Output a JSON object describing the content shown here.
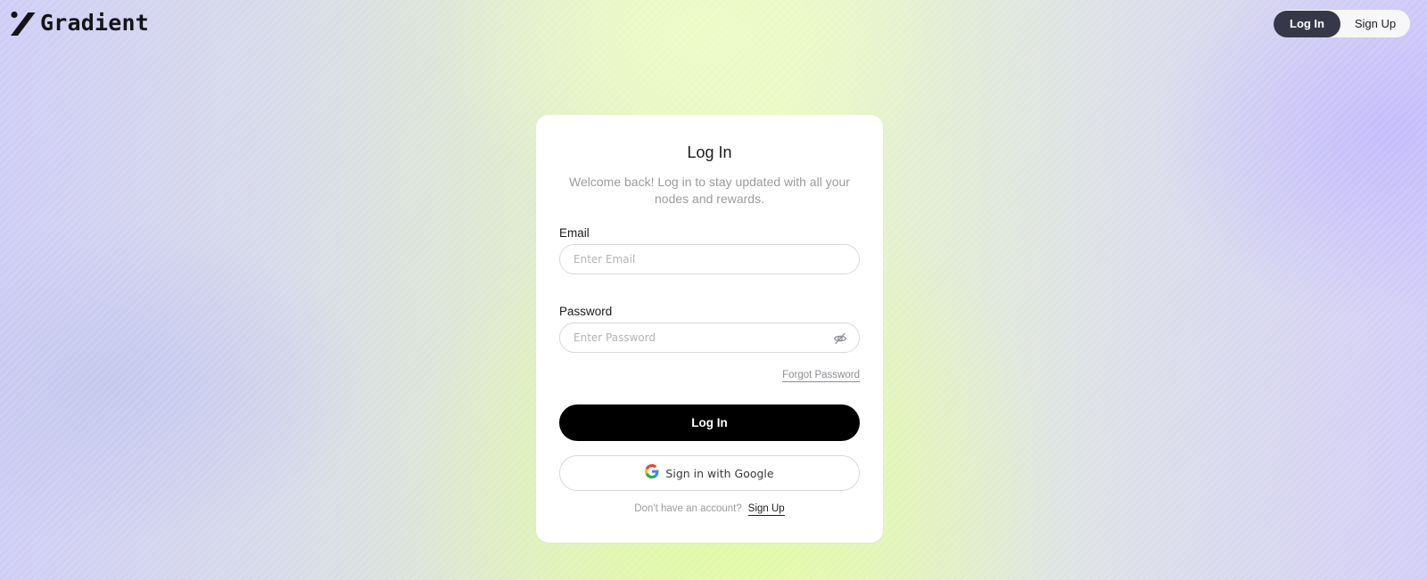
{
  "header": {
    "logo_text": "Gradient",
    "login_label": "Log In",
    "signup_label": "Sign Up"
  },
  "card": {
    "title": "Log In",
    "subtitle": "Welcome back! Log in to stay updated with all your nodes and rewards.",
    "email": {
      "label": "Email",
      "placeholder": "Enter Email",
      "value": ""
    },
    "password": {
      "label": "Password",
      "placeholder": "Enter Password",
      "value": "",
      "toggle_icon": "eye-off-icon"
    },
    "forgot_label": "Forgot Password",
    "login_button_label": "Log In",
    "google_button_label": "Sign in with Google",
    "google_icon": "google-icon",
    "no_account_text": "Don't have an account?",
    "signup_link_label": "Sign Up"
  },
  "colors": {
    "primary_button": "#000000",
    "toggle_active": "#363848",
    "muted_text": "#9b9b9f"
  }
}
